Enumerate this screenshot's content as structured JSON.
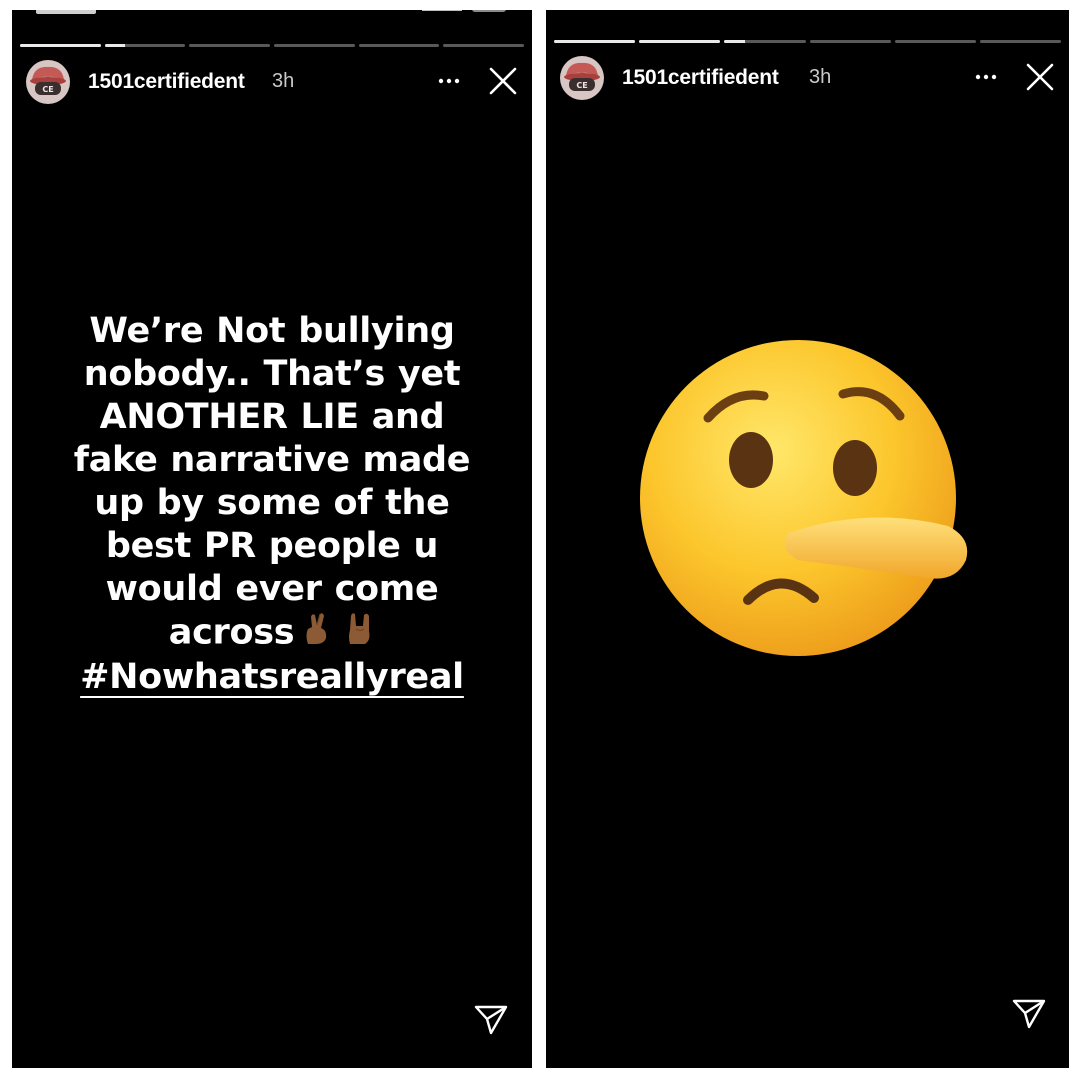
{
  "stories": [
    {
      "username": "1501certifiedent",
      "time_ago": "3h",
      "progress": [
        1.0,
        0.25,
        0,
        0,
        0,
        0
      ],
      "text_lines": [
        "We’re Not bullying",
        "nobody.. That’s yet",
        "ANOTHER LIE and",
        "fake narrative made",
        "up by some of the",
        "best PR people u",
        "would ever come",
        "across"
      ],
      "hashtag": "#Nowhatsreallyreal",
      "inline_emoji": [
        "crossed-fingers-dark",
        "sign-of-the-horns-dark"
      ]
    },
    {
      "username": "1501certifiedent",
      "time_ago": "3h",
      "progress": [
        1.0,
        1.0,
        0.25,
        0,
        0,
        0
      ],
      "sticker": "lying-face-emoji"
    }
  ],
  "icons": {
    "more": "more-dots-icon",
    "close": "close-x-icon",
    "share": "send-direct-icon"
  },
  "colors": {
    "background": "#000000",
    "text": "#ffffff",
    "frame": "#ffffff",
    "progress_track": "rgba(255,255,255,0.35)",
    "progress_fill": "#e9e9e9",
    "emoji_yellow": "#f9c62b"
  }
}
